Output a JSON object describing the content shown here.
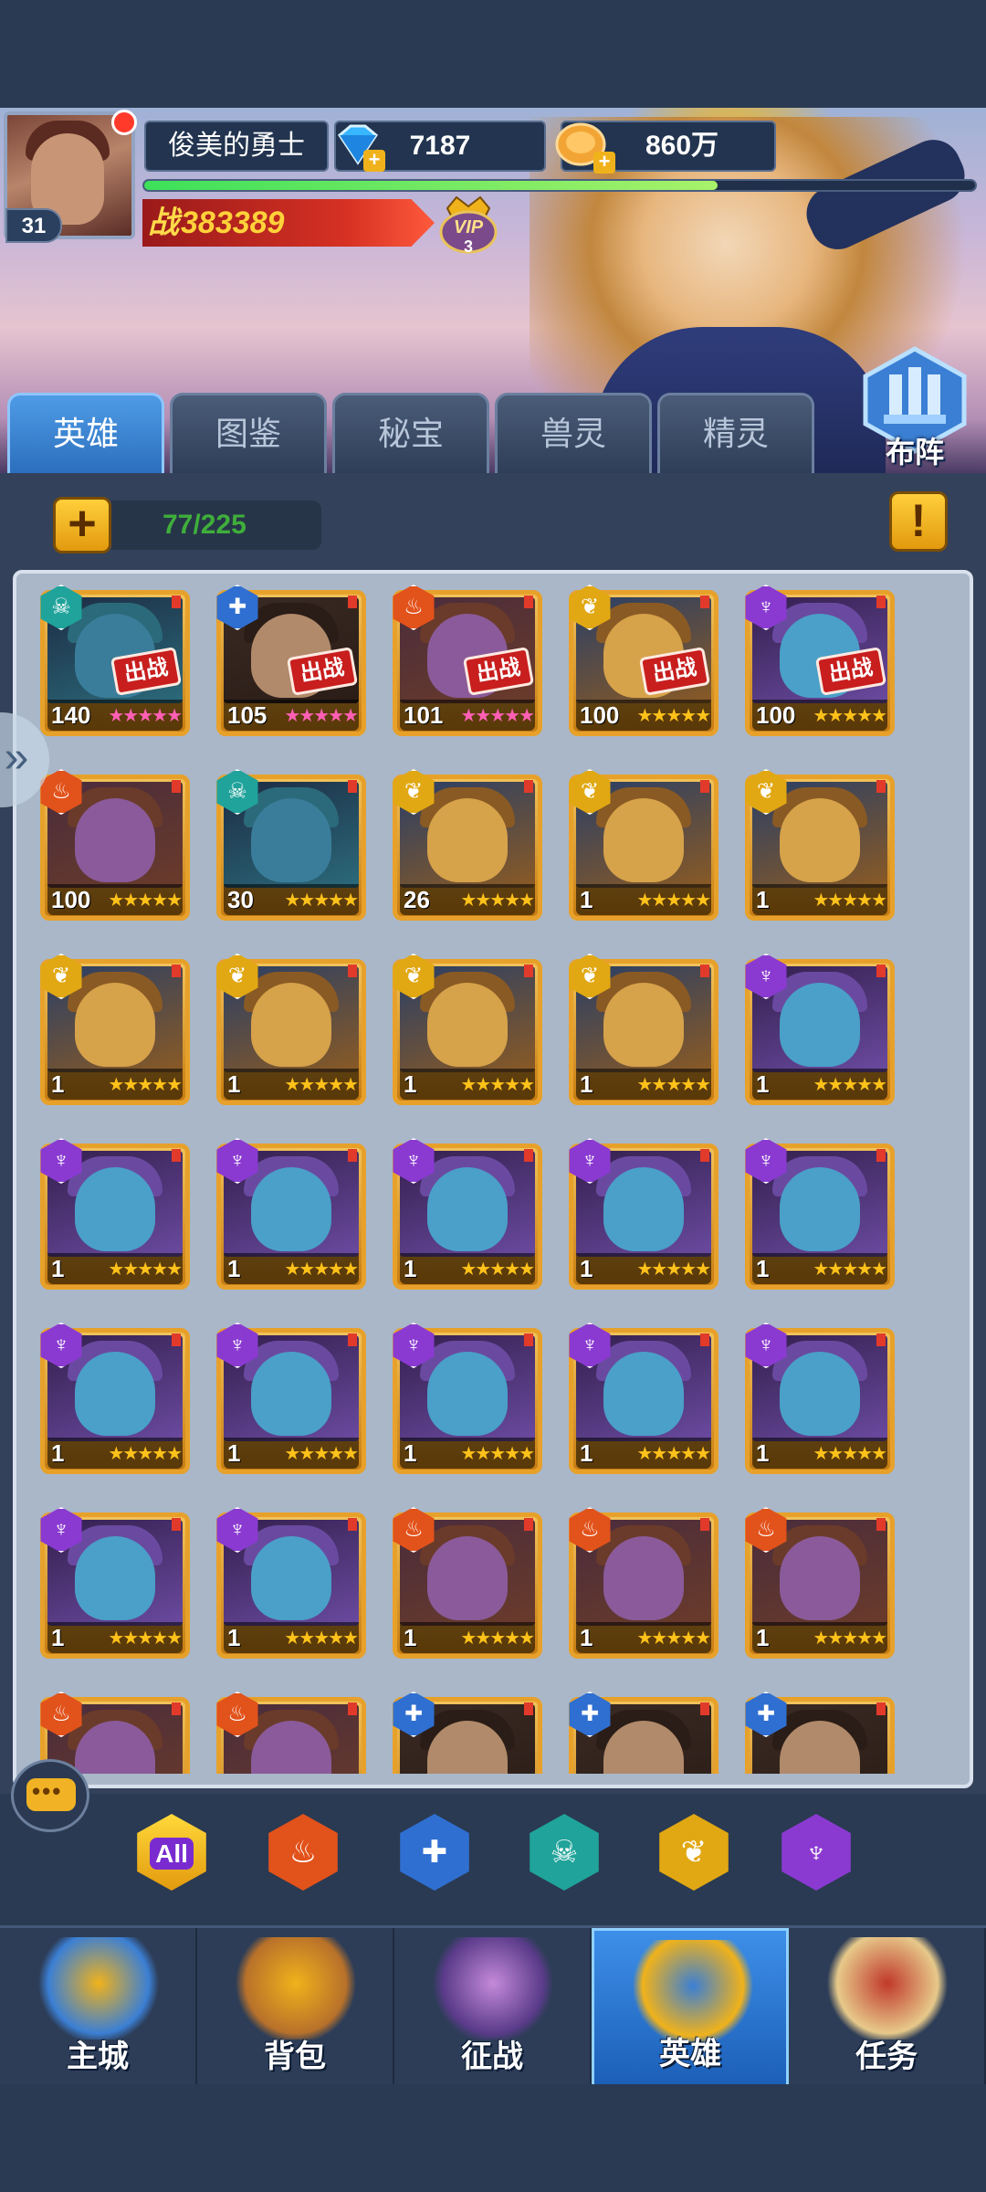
{
  "player": {
    "name": "俊美的勇士",
    "level": "31",
    "gems": "7187",
    "gold": "860万",
    "xp_progress": 0.69,
    "power_prefix": "战",
    "power": "383389",
    "vip_label": "VIP",
    "vip_level": "3"
  },
  "tabs": [
    {
      "label": "英雄",
      "active": true
    },
    {
      "label": "图鉴",
      "active": false
    },
    {
      "label": "秘宝",
      "active": false
    },
    {
      "label": "兽灵",
      "active": false
    },
    {
      "label": "精灵",
      "active": false
    }
  ],
  "deploy_label": "布阵",
  "hero_count": "77/225",
  "plus_symbol": "+",
  "info_symbol": "!",
  "deployed_stamp": "出战",
  "colors": {
    "accent_blue": "#2b6fbd",
    "gold": "#e29a0e",
    "count_green": "#3fae3b",
    "faction_red": "#e2521b",
    "faction_blue": "#2f6fd1",
    "faction_teal": "#1fa39a",
    "faction_yellow": "#e1a813",
    "faction_purple": "#8a3ad1",
    "star_pink": "#ff5fb4",
    "star_gold": "#ffc21a"
  },
  "heroes": [
    {
      "level": "140",
      "faction": "teal",
      "stars": "pink",
      "deployed": true
    },
    {
      "level": "105",
      "faction": "blue",
      "stars": "pink",
      "deployed": true
    },
    {
      "level": "101",
      "faction": "red",
      "stars": "pink",
      "deployed": true
    },
    {
      "level": "100",
      "faction": "yellow",
      "stars": "gold",
      "deployed": true
    },
    {
      "level": "100",
      "faction": "purple",
      "stars": "gold",
      "deployed": true
    },
    {
      "level": "100",
      "faction": "red",
      "stars": "gold",
      "deployed": false
    },
    {
      "level": "30",
      "faction": "teal",
      "stars": "gold",
      "deployed": false
    },
    {
      "level": "26",
      "faction": "yellow",
      "stars": "gold",
      "deployed": false
    },
    {
      "level": "1",
      "faction": "yellow",
      "stars": "gold",
      "deployed": false
    },
    {
      "level": "1",
      "faction": "yellow",
      "stars": "gold",
      "deployed": false
    },
    {
      "level": "1",
      "faction": "yellow",
      "stars": "gold",
      "deployed": false
    },
    {
      "level": "1",
      "faction": "yellow",
      "stars": "gold",
      "deployed": false
    },
    {
      "level": "1",
      "faction": "yellow",
      "stars": "gold",
      "deployed": false
    },
    {
      "level": "1",
      "faction": "yellow",
      "stars": "gold",
      "deployed": false
    },
    {
      "level": "1",
      "faction": "purple",
      "stars": "gold",
      "deployed": false
    },
    {
      "level": "1",
      "faction": "purple",
      "stars": "gold",
      "deployed": false
    },
    {
      "level": "1",
      "faction": "purple",
      "stars": "gold",
      "deployed": false
    },
    {
      "level": "1",
      "faction": "purple",
      "stars": "gold",
      "deployed": false
    },
    {
      "level": "1",
      "faction": "purple",
      "stars": "gold",
      "deployed": false
    },
    {
      "level": "1",
      "faction": "purple",
      "stars": "gold",
      "deployed": false
    },
    {
      "level": "1",
      "faction": "purple",
      "stars": "gold",
      "deployed": false
    },
    {
      "level": "1",
      "faction": "purple",
      "stars": "gold",
      "deployed": false
    },
    {
      "level": "1",
      "faction": "purple",
      "stars": "gold",
      "deployed": false
    },
    {
      "level": "1",
      "faction": "purple",
      "stars": "gold",
      "deployed": false
    },
    {
      "level": "1",
      "faction": "purple",
      "stars": "gold",
      "deployed": false
    },
    {
      "level": "1",
      "faction": "purple",
      "stars": "gold",
      "deployed": false
    },
    {
      "level": "1",
      "faction": "purple",
      "stars": "gold",
      "deployed": false
    },
    {
      "level": "1",
      "faction": "red",
      "stars": "gold",
      "deployed": false
    },
    {
      "level": "1",
      "faction": "red",
      "stars": "gold",
      "deployed": false
    },
    {
      "level": "1",
      "faction": "red",
      "stars": "gold",
      "deployed": false
    },
    {
      "level": "",
      "faction": "red",
      "stars": "gold",
      "deployed": false
    },
    {
      "level": "",
      "faction": "red",
      "stars": "gold",
      "deployed": false
    },
    {
      "level": "",
      "faction": "blue",
      "stars": "gold",
      "deployed": false
    },
    {
      "level": "",
      "faction": "blue",
      "stars": "gold",
      "deployed": false
    },
    {
      "level": "",
      "faction": "blue",
      "stars": "gold",
      "deployed": false
    }
  ],
  "filters": [
    {
      "label": "All",
      "icon": "all-icon",
      "faction": "all"
    },
    {
      "label": "",
      "icon": "flame-faction-icon",
      "faction": "red"
    },
    {
      "label": "",
      "icon": "cross-faction-icon",
      "faction": "blue"
    },
    {
      "label": "",
      "icon": "skull-faction-icon",
      "faction": "teal"
    },
    {
      "label": "",
      "icon": "wing-faction-icon",
      "faction": "yellow"
    },
    {
      "label": "",
      "icon": "trident-faction-icon",
      "faction": "purple"
    }
  ],
  "nav": [
    {
      "label": "主城",
      "icon": "castle-icon",
      "active": false
    },
    {
      "label": "背包",
      "icon": "chest-icon",
      "active": false
    },
    {
      "label": "征战",
      "icon": "dragon-portal-icon",
      "active": false
    },
    {
      "label": "英雄",
      "icon": "helmet-icon",
      "active": true
    },
    {
      "label": "任务",
      "icon": "scroll-icon",
      "active": false
    }
  ]
}
